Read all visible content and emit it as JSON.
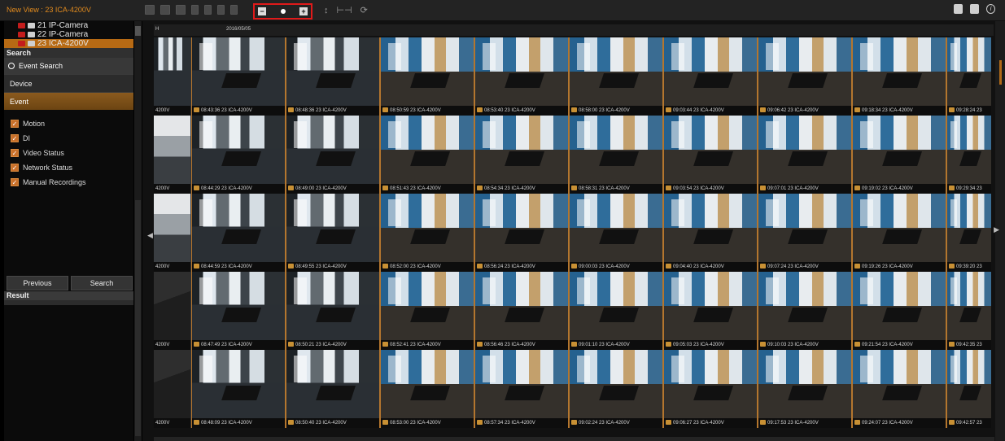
{
  "window": {
    "title": "New View : 23 ICA-4200V"
  },
  "cameras": [
    {
      "label": "21 IP-Camera",
      "selected": false
    },
    {
      "label": "22 IP-Camera",
      "selected": false
    },
    {
      "label": "23 ICA-4200V",
      "selected": true
    }
  ],
  "search_panel": {
    "title": "Search",
    "event_search_label": "Event Search",
    "device_tab": "Device",
    "event_tab": "Event",
    "event_types": [
      {
        "label": "Motion",
        "checked": true
      },
      {
        "label": "DI",
        "checked": true
      },
      {
        "label": "Video Status",
        "checked": true
      },
      {
        "label": "Network Status",
        "checked": true
      },
      {
        "label": "Manual Recordings",
        "checked": true
      }
    ],
    "previous_button": "Previous",
    "search_button": "Search",
    "result_title": "Result"
  },
  "timeline": {
    "left_label": "H",
    "date": "2016/05/05"
  },
  "grid": {
    "partial_label": "4200V",
    "rows": [
      [
        "08:43:36 23 ICA-4200V",
        "08:48:36 23 ICA-4200V",
        "08:50:59 23 ICA-4200V",
        "08:53:40 23 ICA-4200V",
        "08:58:00 23 ICA-4200V",
        "09:03:44 23 ICA-4200V",
        "09:06:42 23 ICA-4200V",
        "09:18:34 23 ICA-4200V",
        "09:28:24 23"
      ],
      [
        "08:44:29 23 ICA-4200V",
        "08:49:00 23 ICA-4200V",
        "08:51:43 23 ICA-4200V",
        "08:54:34 23 ICA-4200V",
        "08:58:31 23 ICA-4200V",
        "09:03:54 23 ICA-4200V",
        "09:07:01 23 ICA-4200V",
        "09:19:02 23 ICA-4200V",
        "09:29:34 23"
      ],
      [
        "08:44:59 23 ICA-4200V",
        "08:49:55 23 ICA-4200V",
        "08:52:00 23 ICA-4200V",
        "08:56:24 23 ICA-4200V",
        "09:00:03 23 ICA-4200V",
        "09:04:40 23 ICA-4200V",
        "09:07:24 23 ICA-4200V",
        "09:19:26 23 ICA-4200V",
        "09:39:20 23"
      ],
      [
        "08:47:49 23 ICA-4200V",
        "08:50:21 23 ICA-4200V",
        "08:52:41 23 ICA-4200V",
        "08:56:46 23 ICA-4200V",
        "09:01:10 23 ICA-4200V",
        "09:05:03 23 ICA-4200V",
        "09:10:03 23 ICA-4200V",
        "09:21:54 23 ICA-4200V",
        "09:42:35 23"
      ],
      [
        "08:48:09 23 ICA-4200V",
        "08:50:40 23 ICA-4200V",
        "08:53:00 23 ICA-4200V",
        "08:57:34 23 ICA-4200V",
        "09:02:24 23 ICA-4200V",
        "09:06:27 23 ICA-4200V",
        "09:17:53 23 ICA-4200V",
        "09:24:07 23 ICA-4200V",
        "09:42:57 23"
      ]
    ]
  },
  "colors": {
    "accent": "#b76a14",
    "highlight_box": "#e01a1a"
  }
}
